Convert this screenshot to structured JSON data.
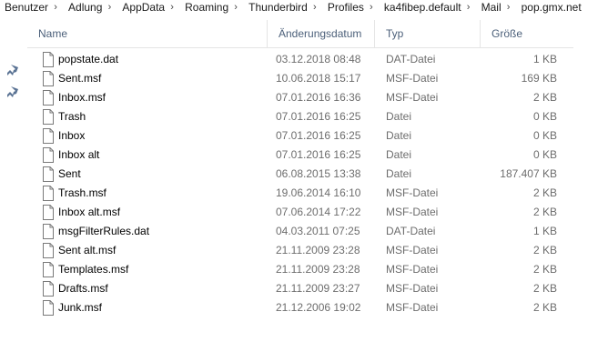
{
  "breadcrumb": [
    "Benutzer",
    "Adlung",
    "AppData",
    "Roaming",
    "Thunderbird",
    "Profiles",
    "ka4fibep.default",
    "Mail",
    "pop.gmx.net"
  ],
  "columns": {
    "name": "Name",
    "date": "Änderungsdatum",
    "type": "Typ",
    "size": "Größe"
  },
  "files": [
    {
      "name": "popstate.dat",
      "date": "03.12.2018 08:48",
      "type": "DAT-Datei",
      "size": "1 KB"
    },
    {
      "name": "Sent.msf",
      "date": "10.06.2018 15:17",
      "type": "MSF-Datei",
      "size": "169 KB"
    },
    {
      "name": "Inbox.msf",
      "date": "07.01.2016 16:36",
      "type": "MSF-Datei",
      "size": "2 KB"
    },
    {
      "name": "Trash",
      "date": "07.01.2016 16:25",
      "type": "Datei",
      "size": "0 KB"
    },
    {
      "name": "Inbox",
      "date": "07.01.2016 16:25",
      "type": "Datei",
      "size": "0 KB"
    },
    {
      "name": "Inbox alt",
      "date": "07.01.2016 16:25",
      "type": "Datei",
      "size": "0 KB"
    },
    {
      "name": "Sent",
      "date": "06.08.2015 13:38",
      "type": "Datei",
      "size": "187.407 KB"
    },
    {
      "name": "Trash.msf",
      "date": "19.06.2014 16:10",
      "type": "MSF-Datei",
      "size": "2 KB"
    },
    {
      "name": "Inbox alt.msf",
      "date": "07.06.2014 17:22",
      "type": "MSF-Datei",
      "size": "2 KB"
    },
    {
      "name": "msgFilterRules.dat",
      "date": "04.03.2011 07:25",
      "type": "DAT-Datei",
      "size": "1 KB"
    },
    {
      "name": "Sent alt.msf",
      "date": "21.11.2009 23:28",
      "type": "MSF-Datei",
      "size": "2 KB"
    },
    {
      "name": "Templates.msf",
      "date": "21.11.2009 23:28",
      "type": "MSF-Datei",
      "size": "2 KB"
    },
    {
      "name": "Drafts.msf",
      "date": "21.11.2009 23:27",
      "type": "MSF-Datei",
      "size": "2 KB"
    },
    {
      "name": "Junk.msf",
      "date": "21.12.2006 19:02",
      "type": "MSF-Datei",
      "size": "2 KB"
    }
  ],
  "icons": {
    "file": "file-icon",
    "pin": "pin-icon",
    "separator": "chevron-right-icon"
  },
  "colors": {
    "header_text": "#4c607a",
    "secondary_text": "#6d6d6d",
    "divider": "#e5e5e5"
  }
}
